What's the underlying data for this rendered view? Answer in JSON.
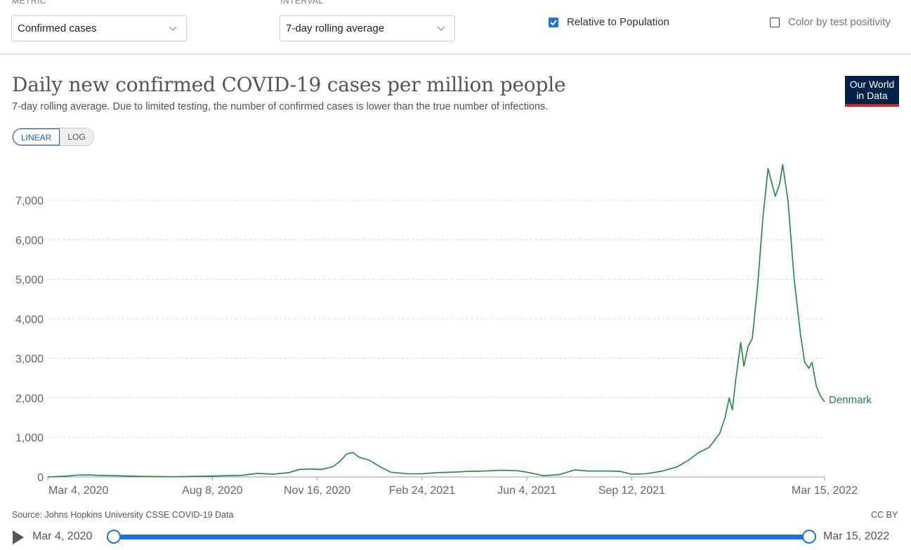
{
  "controls": {
    "metric_label": "METRIC",
    "metric_value": "Confirmed cases",
    "interval_label": "INTERVAL",
    "interval_value": "7-day rolling average",
    "relative_label": "Relative to Population",
    "relative_checked": true,
    "positivity_label": "Color by test positivity",
    "positivity_checked": false
  },
  "header": {
    "title": "Daily new confirmed COVID-19 cases per million people",
    "subtitle": "7-day rolling average. Due to limited testing, the number of confirmed cases is lower than the true number of infections.",
    "logo_line1": "Our World",
    "logo_line2": "in Data"
  },
  "scale": {
    "linear_label": "LINEAR",
    "log_label": "LOG",
    "active": "LINEAR"
  },
  "chart_data": {
    "type": "line",
    "title": "Daily new confirmed COVID-19 cases per million people",
    "xlabel": "",
    "ylabel": "",
    "ylim": [
      0,
      7000
    ],
    "grid": true,
    "x_ticks": [
      "Mar 4, 2020",
      "Aug 8, 2020",
      "Nov 16, 2020",
      "Feb 24, 2021",
      "Jun 4, 2021",
      "Sep 12, 2021",
      "Mar 15, 2022"
    ],
    "y_ticks": [
      0,
      1000,
      2000,
      3000,
      4000,
      5000,
      6000,
      7000
    ],
    "y_tick_labels": [
      "0",
      "1,000",
      "2,000",
      "3,000",
      "4,000",
      "5,000",
      "6,000",
      "7,000"
    ],
    "series": [
      {
        "name": "Denmark",
        "color": "#1a8a3c",
        "points": [
          [
            "2020-03-04",
            0
          ],
          [
            "2020-03-20",
            20
          ],
          [
            "2020-04-01",
            45
          ],
          [
            "2020-04-10",
            55
          ],
          [
            "2020-04-20",
            40
          ],
          [
            "2020-05-10",
            30
          ],
          [
            "2020-06-01",
            15
          ],
          [
            "2020-07-01",
            5
          ],
          [
            "2020-08-01",
            20
          ],
          [
            "2020-08-20",
            30
          ],
          [
            "2020-09-05",
            40
          ],
          [
            "2020-09-20",
            90
          ],
          [
            "2020-10-05",
            70
          ],
          [
            "2020-10-20",
            110
          ],
          [
            "2020-10-30",
            190
          ],
          [
            "2020-11-10",
            200
          ],
          [
            "2020-11-20",
            190
          ],
          [
            "2020-12-01",
            260
          ],
          [
            "2020-12-08",
            400
          ],
          [
            "2020-12-14",
            580
          ],
          [
            "2020-12-20",
            620
          ],
          [
            "2020-12-26",
            500
          ],
          [
            "2021-01-05",
            420
          ],
          [
            "2021-01-15",
            260
          ],
          [
            "2021-01-25",
            120
          ],
          [
            "2021-02-10",
            80
          ],
          [
            "2021-02-24",
            80
          ],
          [
            "2021-03-10",
            110
          ],
          [
            "2021-03-25",
            120
          ],
          [
            "2021-04-10",
            140
          ],
          [
            "2021-04-25",
            150
          ],
          [
            "2021-05-10",
            170
          ],
          [
            "2021-05-25",
            160
          ],
          [
            "2021-06-04",
            120
          ],
          [
            "2021-06-20",
            30
          ],
          [
            "2021-07-05",
            60
          ],
          [
            "2021-07-20",
            180
          ],
          [
            "2021-08-01",
            150
          ],
          [
            "2021-08-20",
            150
          ],
          [
            "2021-09-01",
            140
          ],
          [
            "2021-09-12",
            70
          ],
          [
            "2021-09-25",
            80
          ],
          [
            "2021-10-10",
            140
          ],
          [
            "2021-10-25",
            250
          ],
          [
            "2021-11-05",
            420
          ],
          [
            "2021-11-15",
            620
          ],
          [
            "2021-11-25",
            750
          ],
          [
            "2021-12-05",
            1100
          ],
          [
            "2021-12-10",
            1500
          ],
          [
            "2021-12-14",
            2000
          ],
          [
            "2021-12-17",
            1700
          ],
          [
            "2021-12-20",
            2400
          ],
          [
            "2021-12-25",
            3400
          ],
          [
            "2021-12-28",
            2800
          ],
          [
            "2022-01-01",
            3300
          ],
          [
            "2022-01-05",
            3500
          ],
          [
            "2022-01-10",
            4800
          ],
          [
            "2022-01-15",
            6500
          ],
          [
            "2022-01-20",
            7800
          ],
          [
            "2022-01-23",
            7500
          ],
          [
            "2022-01-27",
            7100
          ],
          [
            "2022-01-31",
            7400
          ],
          [
            "2022-02-03",
            7900
          ],
          [
            "2022-02-08",
            7000
          ],
          [
            "2022-02-14",
            5000
          ],
          [
            "2022-02-20",
            3600
          ],
          [
            "2022-02-24",
            2900
          ],
          [
            "2022-02-28",
            2750
          ],
          [
            "2022-03-03",
            2900
          ],
          [
            "2022-03-07",
            2300
          ],
          [
            "2022-03-11",
            2050
          ],
          [
            "2022-03-15",
            1900
          ]
        ]
      }
    ]
  },
  "footer": {
    "source": "Source: Johns Hopkins University CSSE COVID-19 Data",
    "license": "CC BY"
  },
  "timeline": {
    "start_label": "Mar 4, 2020",
    "end_label": "Mar 15, 2022"
  }
}
